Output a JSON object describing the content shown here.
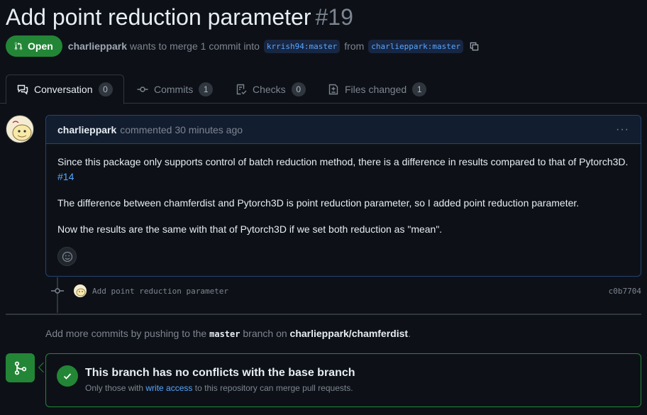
{
  "pr": {
    "title": "Add point reduction parameter",
    "number": "#19",
    "status": "Open",
    "author": "charlieppark",
    "merge_text": "wants to merge 1 commit into",
    "base_branch": "krrish94:master",
    "from_text": "from",
    "head_branch": "charlieppark:master"
  },
  "tabs": [
    {
      "label": "Conversation",
      "count": "0",
      "icon": "comment-discussion-icon"
    },
    {
      "label": "Commits",
      "count": "1",
      "icon": "git-commit-icon"
    },
    {
      "label": "Checks",
      "count": "0",
      "icon": "checklist-icon"
    },
    {
      "label": "Files changed",
      "count": "1",
      "icon": "file-diff-icon"
    }
  ],
  "comment": {
    "author": "charlieppark",
    "action": "commented",
    "time": "30 minutes ago",
    "p1": "Since this package only supports control of batch reduction method, there is a difference in results compared to that of Pytorch3D.",
    "p1_link": "#14",
    "p2": "The difference between chamferdist and Pytorch3D is point reduction parameter, so I added point reduction parameter.",
    "p3": "Now the results are the same with that of Pytorch3D if we set both reduction as \"mean\"."
  },
  "commit": {
    "message": "Add point reduction parameter",
    "sha": "c0b7704"
  },
  "hint": {
    "prefix": "Add more commits by pushing to the",
    "branch": "master",
    "middle": "branch on",
    "repo": "charlieppark/chamferdist",
    "suffix": "."
  },
  "merge": {
    "title": "This branch has no conflicts with the base branch",
    "sub_prefix": "Only those with",
    "sub_link": "write access",
    "sub_suffix": "to this repository can merge pull requests."
  },
  "colors": {
    "accent_green": "#238636",
    "link_blue": "#58a6ff",
    "bg": "#0d1117"
  }
}
